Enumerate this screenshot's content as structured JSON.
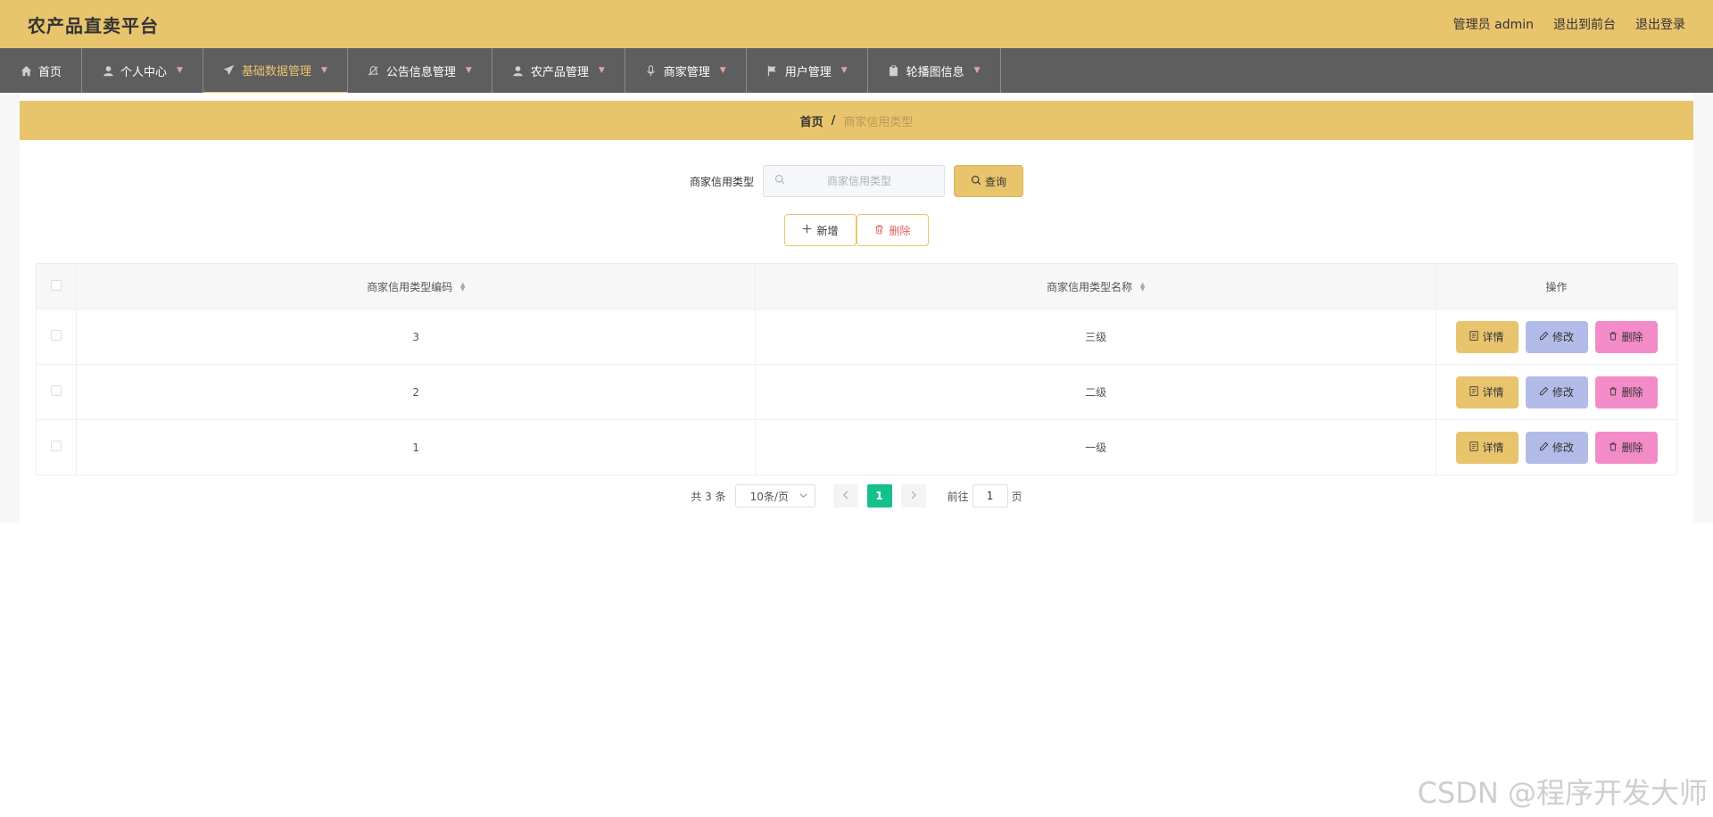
{
  "header": {
    "title": "农产品直卖平台",
    "admin_label": "管理员 admin",
    "to_front": "退出到前台",
    "logout": "退出登录"
  },
  "nav": {
    "items": [
      {
        "label": "首页",
        "icon": "home-icon"
      },
      {
        "label": "个人中心",
        "icon": "user-icon"
      },
      {
        "label": "基础数据管理",
        "icon": "send-icon",
        "active": true
      },
      {
        "label": "公告信息管理",
        "icon": "bell-off-icon"
      },
      {
        "label": "农产品管理",
        "icon": "user-icon"
      },
      {
        "label": "商家管理",
        "icon": "microphone-icon"
      },
      {
        "label": "用户管理",
        "icon": "flag-icon"
      },
      {
        "label": "轮播图信息",
        "icon": "clipboard-icon"
      }
    ]
  },
  "breadcrumb": {
    "home": "首页",
    "separator": "/",
    "current": "商家信用类型"
  },
  "search": {
    "label": "商家信用类型",
    "placeholder": "商家信用类型",
    "query_label": "查询"
  },
  "actions": {
    "add_label": "新增",
    "delete_label": "删除"
  },
  "table": {
    "headers": {
      "code": "商家信用类型编码",
      "name": "商家信用类型名称",
      "ops": "操作"
    },
    "rows": [
      {
        "code": "3",
        "name": "三级"
      },
      {
        "code": "2",
        "name": "二级"
      },
      {
        "code": "1",
        "name": "一级"
      }
    ],
    "op_labels": {
      "detail": "详情",
      "edit": "修改",
      "delete": "删除"
    }
  },
  "pagination": {
    "total": "共 3 条",
    "page_size": "10条/页",
    "current_page": "1",
    "goto_label": "前往",
    "goto_value": "1",
    "page_suffix": "页"
  },
  "watermark": "CSDN @程序开发大师",
  "colors": {
    "primary": "#e8c46d",
    "nav_bg": "#5e5e5e",
    "page_active": "#13c08e",
    "edit_btn": "#b3bbe8",
    "delete_btn": "#f38bc9"
  }
}
